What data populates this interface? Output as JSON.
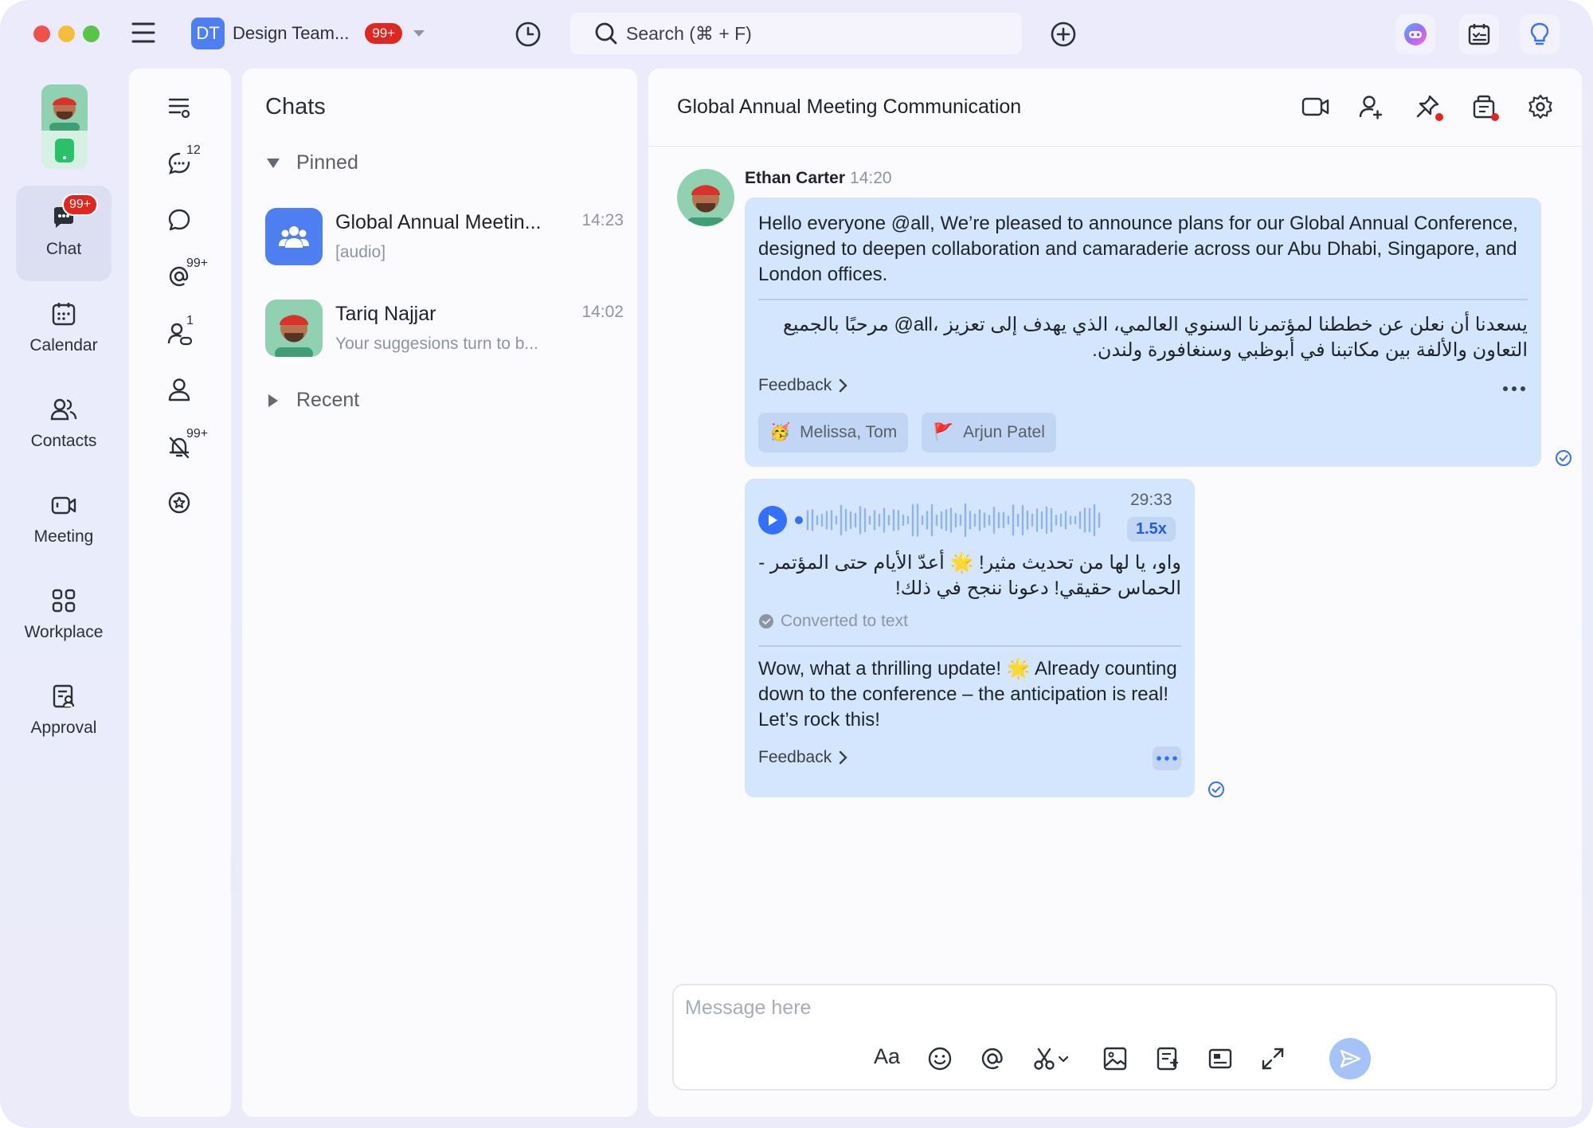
{
  "titlebar": {
    "workspace_initials": "DT",
    "workspace_name": "Design Team...",
    "workspace_badge": "99+",
    "search_placeholder": "Search (⌘ + F)"
  },
  "rail": {
    "chat_badge": "99+",
    "items": [
      {
        "label": "Chat"
      },
      {
        "label": "Calendar"
      },
      {
        "label": "Contacts"
      },
      {
        "label": "Meeting"
      },
      {
        "label": "Workplace"
      },
      {
        "label": "Approval"
      }
    ]
  },
  "filters": {
    "unread_count": "12",
    "mentions_count": "99+",
    "requests_count": "1",
    "muted_count": "99+"
  },
  "chat_list": {
    "title": "Chats",
    "pinned_label": "Pinned",
    "recent_label": "Recent",
    "items": [
      {
        "name": "Global Annual Meetin...",
        "preview": "[audio]",
        "time": "14:23"
      },
      {
        "name": "Tariq Najjar",
        "preview": "Your suggesions turn to b...",
        "time": "14:02"
      }
    ]
  },
  "conversation": {
    "title": "Global Annual Meeting Communication",
    "sender": "Ethan Carter",
    "sender_time": "14:20",
    "message1": {
      "text_en": "Hello everyone @all, We’re pleased to announce plans for our Global Annual Conference, designed to deepen collaboration and camaraderie across our Abu Dhabi, Singapore, and London offices.",
      "text_ar": "يسعدنا أن نعلن عن خططنا لمؤتمرنا السنوي العالمي، الذي يهدف إلى تعزيز ،all@ مرحبًا بالجميع التعاون والألفة بين مكاتبنا في أبوظبي وسنغافورة ولندن.",
      "feedback": "Feedback",
      "reactions": [
        {
          "emoji": "🥳",
          "names": "Melissa, Tom"
        },
        {
          "emoji": "🚩",
          "names": "Arjun Patel"
        }
      ]
    },
    "message2": {
      "duration": "29:33",
      "speed": "1.5x",
      "transcript_ar": "واو، يا لها من تحديث مثير! 🌟 أعدّ الأيام حتى المؤتمر - الحماس حقيقي! دعونا ننجح في ذلك!",
      "converted_label": "Converted to text",
      "translation_en": "Wow, what a thrilling update! 🌟 Already counting down to the conference – the anticipation is real! Let’s rock this!",
      "feedback": "Feedback"
    }
  },
  "composer": {
    "placeholder": "Message here",
    "font_label": "Aa"
  },
  "colors": {
    "accent": "#3370ff",
    "bubble": "#d4e6fd",
    "badge_red": "#e0261f"
  }
}
